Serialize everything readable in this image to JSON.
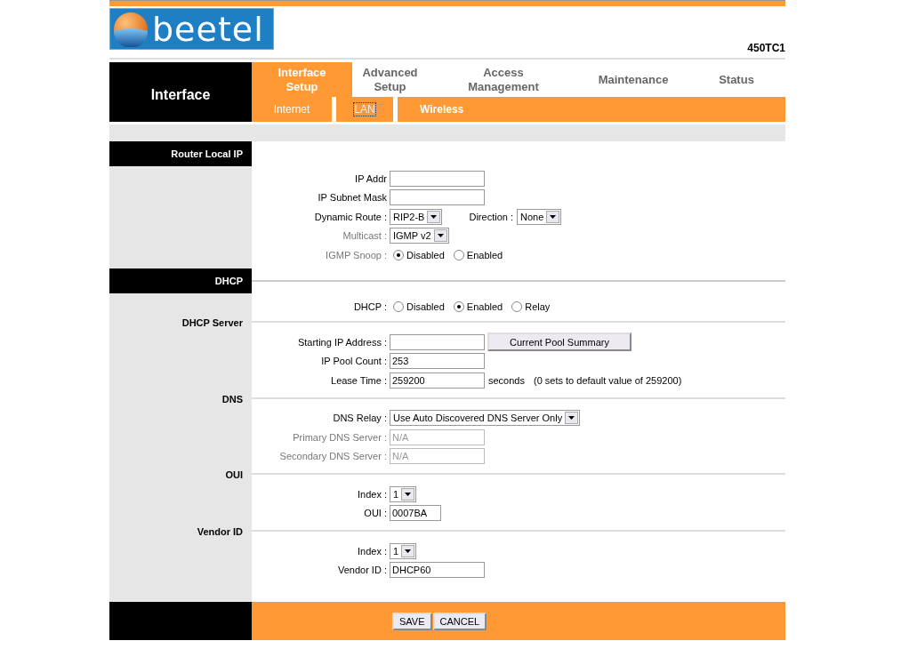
{
  "logo": {
    "text": "beetel"
  },
  "model": "450TC1",
  "nav": {
    "section": "Interface",
    "tabs": [
      {
        "label": "Interface Setup",
        "selected": true
      },
      {
        "label": "Advanced Setup",
        "selected": false
      },
      {
        "label": "Access Management",
        "selected": false
      },
      {
        "label": "Maintenance",
        "selected": false
      },
      {
        "label": "Status",
        "selected": false
      }
    ],
    "subtabs": [
      {
        "label": "Internet",
        "selected": false,
        "bold": false
      },
      {
        "label": "LAN",
        "selected": true,
        "bold": false
      },
      {
        "label": "Wireless",
        "selected": false,
        "bold": true
      }
    ]
  },
  "router_local_ip": {
    "heading": "Router Local IP",
    "fields": [
      {
        "kind": "text",
        "label": "IP Addr",
        "disabled": false
      },
      {
        "kind": "text",
        "label": "IP Subnet Mask",
        "disabled": false
      },
      {
        "kind": "select_pair",
        "label": "Dynamic Route :",
        "value": "RIP2-B",
        "label2": "Direction :",
        "value2": "None",
        "disabled": false
      },
      {
        "kind": "select",
        "label": "Multicast :",
        "value": "IGMP v2",
        "disabled": true
      },
      {
        "kind": "radio",
        "label": "IGMP Snoop :",
        "disabled": true,
        "options": [
          {
            "label": "Disabled",
            "selected": true
          },
          {
            "label": "Enabled",
            "selected": false
          }
        ]
      }
    ]
  },
  "dhcp": {
    "heading": "DHCP",
    "mode": {
      "kind": "radio",
      "label": "DHCP :",
      "disabled": false,
      "options": [
        {
          "label": "Disabled",
          "selected": false
        },
        {
          "label": "Enabled",
          "selected": true
        },
        {
          "label": "Relay",
          "selected": false
        }
      ]
    },
    "groups": [
      {
        "title": "DHCP Server",
        "fields": [
          {
            "kind": "text_button",
            "label": "Starting IP Address :",
            "button": "Current Pool Summary",
            "disabled": false
          },
          {
            "kind": "text",
            "label": "IP Pool Count :",
            "value": "253",
            "disabled": false
          },
          {
            "kind": "text_note",
            "label": "Lease Time :",
            "value": "259200",
            "unit": "seconds",
            "note": "(0 sets to default value of 259200)",
            "disabled": false
          }
        ]
      },
      {
        "title": "DNS",
        "fields": [
          {
            "kind": "select",
            "label": "DNS Relay :",
            "value": "Use Auto Discovered DNS Server Only",
            "disabled": false
          },
          {
            "kind": "text",
            "label": "Primary DNS Server :",
            "value": "N/A",
            "disabled": true
          },
          {
            "kind": "text",
            "label": "Secondary DNS Server :",
            "value": "N/A",
            "disabled": true
          }
        ]
      },
      {
        "title": "OUI",
        "fields": [
          {
            "kind": "select",
            "label": "Index :",
            "value": "1",
            "disabled": false
          },
          {
            "kind": "text",
            "label": "OUI :",
            "value": "0007BA",
            "disabled": false,
            "short": true
          }
        ]
      },
      {
        "title": "Vendor ID",
        "fields": [
          {
            "kind": "select",
            "label": "Index :",
            "value": "1",
            "disabled": false
          },
          {
            "kind": "text",
            "label": "Vendor ID :",
            "value": "DHCP60",
            "disabled": false
          }
        ]
      }
    ]
  },
  "buttons": [
    "SAVE",
    "CANCEL"
  ]
}
